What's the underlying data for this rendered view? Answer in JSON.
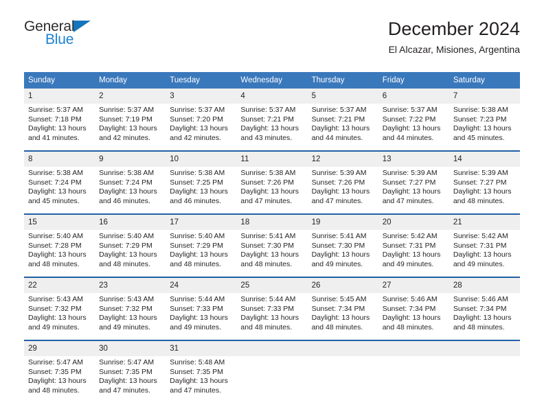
{
  "logo": {
    "word_top": "General",
    "word_bottom": "Blue",
    "triangle_color": "#1574bb",
    "blue_color": "#1b82d2"
  },
  "header": {
    "title": "December 2024",
    "subtitle": "El Alcazar, Misiones, Argentina"
  },
  "theme": {
    "header_band": "#3a78bc",
    "week_separator": "#1f5fa6",
    "daynum_band": "#efefef",
    "text": "#231f20"
  },
  "calendar": {
    "weekday_headers": [
      "Sunday",
      "Monday",
      "Tuesday",
      "Wednesday",
      "Thursday",
      "Friday",
      "Saturday"
    ],
    "weeks": [
      [
        {
          "day": "1",
          "lines": [
            "Sunrise: 5:37 AM",
            "Sunset: 7:18 PM",
            "Daylight: 13 hours",
            "and 41 minutes."
          ]
        },
        {
          "day": "2",
          "lines": [
            "Sunrise: 5:37 AM",
            "Sunset: 7:19 PM",
            "Daylight: 13 hours",
            "and 42 minutes."
          ]
        },
        {
          "day": "3",
          "lines": [
            "Sunrise: 5:37 AM",
            "Sunset: 7:20 PM",
            "Daylight: 13 hours",
            "and 42 minutes."
          ]
        },
        {
          "day": "4",
          "lines": [
            "Sunrise: 5:37 AM",
            "Sunset: 7:21 PM",
            "Daylight: 13 hours",
            "and 43 minutes."
          ]
        },
        {
          "day": "5",
          "lines": [
            "Sunrise: 5:37 AM",
            "Sunset: 7:21 PM",
            "Daylight: 13 hours",
            "and 44 minutes."
          ]
        },
        {
          "day": "6",
          "lines": [
            "Sunrise: 5:37 AM",
            "Sunset: 7:22 PM",
            "Daylight: 13 hours",
            "and 44 minutes."
          ]
        },
        {
          "day": "7",
          "lines": [
            "Sunrise: 5:38 AM",
            "Sunset: 7:23 PM",
            "Daylight: 13 hours",
            "and 45 minutes."
          ]
        }
      ],
      [
        {
          "day": "8",
          "lines": [
            "Sunrise: 5:38 AM",
            "Sunset: 7:24 PM",
            "Daylight: 13 hours",
            "and 45 minutes."
          ]
        },
        {
          "day": "9",
          "lines": [
            "Sunrise: 5:38 AM",
            "Sunset: 7:24 PM",
            "Daylight: 13 hours",
            "and 46 minutes."
          ]
        },
        {
          "day": "10",
          "lines": [
            "Sunrise: 5:38 AM",
            "Sunset: 7:25 PM",
            "Daylight: 13 hours",
            "and 46 minutes."
          ]
        },
        {
          "day": "11",
          "lines": [
            "Sunrise: 5:38 AM",
            "Sunset: 7:26 PM",
            "Daylight: 13 hours",
            "and 47 minutes."
          ]
        },
        {
          "day": "12",
          "lines": [
            "Sunrise: 5:39 AM",
            "Sunset: 7:26 PM",
            "Daylight: 13 hours",
            "and 47 minutes."
          ]
        },
        {
          "day": "13",
          "lines": [
            "Sunrise: 5:39 AM",
            "Sunset: 7:27 PM",
            "Daylight: 13 hours",
            "and 47 minutes."
          ]
        },
        {
          "day": "14",
          "lines": [
            "Sunrise: 5:39 AM",
            "Sunset: 7:27 PM",
            "Daylight: 13 hours",
            "and 48 minutes."
          ]
        }
      ],
      [
        {
          "day": "15",
          "lines": [
            "Sunrise: 5:40 AM",
            "Sunset: 7:28 PM",
            "Daylight: 13 hours",
            "and 48 minutes."
          ]
        },
        {
          "day": "16",
          "lines": [
            "Sunrise: 5:40 AM",
            "Sunset: 7:29 PM",
            "Daylight: 13 hours",
            "and 48 minutes."
          ]
        },
        {
          "day": "17",
          "lines": [
            "Sunrise: 5:40 AM",
            "Sunset: 7:29 PM",
            "Daylight: 13 hours",
            "and 48 minutes."
          ]
        },
        {
          "day": "18",
          "lines": [
            "Sunrise: 5:41 AM",
            "Sunset: 7:30 PM",
            "Daylight: 13 hours",
            "and 48 minutes."
          ]
        },
        {
          "day": "19",
          "lines": [
            "Sunrise: 5:41 AM",
            "Sunset: 7:30 PM",
            "Daylight: 13 hours",
            "and 49 minutes."
          ]
        },
        {
          "day": "20",
          "lines": [
            "Sunrise: 5:42 AM",
            "Sunset: 7:31 PM",
            "Daylight: 13 hours",
            "and 49 minutes."
          ]
        },
        {
          "day": "21",
          "lines": [
            "Sunrise: 5:42 AM",
            "Sunset: 7:31 PM",
            "Daylight: 13 hours",
            "and 49 minutes."
          ]
        }
      ],
      [
        {
          "day": "22",
          "lines": [
            "Sunrise: 5:43 AM",
            "Sunset: 7:32 PM",
            "Daylight: 13 hours",
            "and 49 minutes."
          ]
        },
        {
          "day": "23",
          "lines": [
            "Sunrise: 5:43 AM",
            "Sunset: 7:32 PM",
            "Daylight: 13 hours",
            "and 49 minutes."
          ]
        },
        {
          "day": "24",
          "lines": [
            "Sunrise: 5:44 AM",
            "Sunset: 7:33 PM",
            "Daylight: 13 hours",
            "and 49 minutes."
          ]
        },
        {
          "day": "25",
          "lines": [
            "Sunrise: 5:44 AM",
            "Sunset: 7:33 PM",
            "Daylight: 13 hours",
            "and 48 minutes."
          ]
        },
        {
          "day": "26",
          "lines": [
            "Sunrise: 5:45 AM",
            "Sunset: 7:34 PM",
            "Daylight: 13 hours",
            "and 48 minutes."
          ]
        },
        {
          "day": "27",
          "lines": [
            "Sunrise: 5:46 AM",
            "Sunset: 7:34 PM",
            "Daylight: 13 hours",
            "and 48 minutes."
          ]
        },
        {
          "day": "28",
          "lines": [
            "Sunrise: 5:46 AM",
            "Sunset: 7:34 PM",
            "Daylight: 13 hours",
            "and 48 minutes."
          ]
        }
      ],
      [
        {
          "day": "29",
          "lines": [
            "Sunrise: 5:47 AM",
            "Sunset: 7:35 PM",
            "Daylight: 13 hours",
            "and 48 minutes."
          ]
        },
        {
          "day": "30",
          "lines": [
            "Sunrise: 5:47 AM",
            "Sunset: 7:35 PM",
            "Daylight: 13 hours",
            "and 47 minutes."
          ]
        },
        {
          "day": "31",
          "lines": [
            "Sunrise: 5:48 AM",
            "Sunset: 7:35 PM",
            "Daylight: 13 hours",
            "and 47 minutes."
          ]
        },
        {
          "day": "",
          "lines": []
        },
        {
          "day": "",
          "lines": []
        },
        {
          "day": "",
          "lines": []
        },
        {
          "day": "",
          "lines": []
        }
      ]
    ]
  }
}
